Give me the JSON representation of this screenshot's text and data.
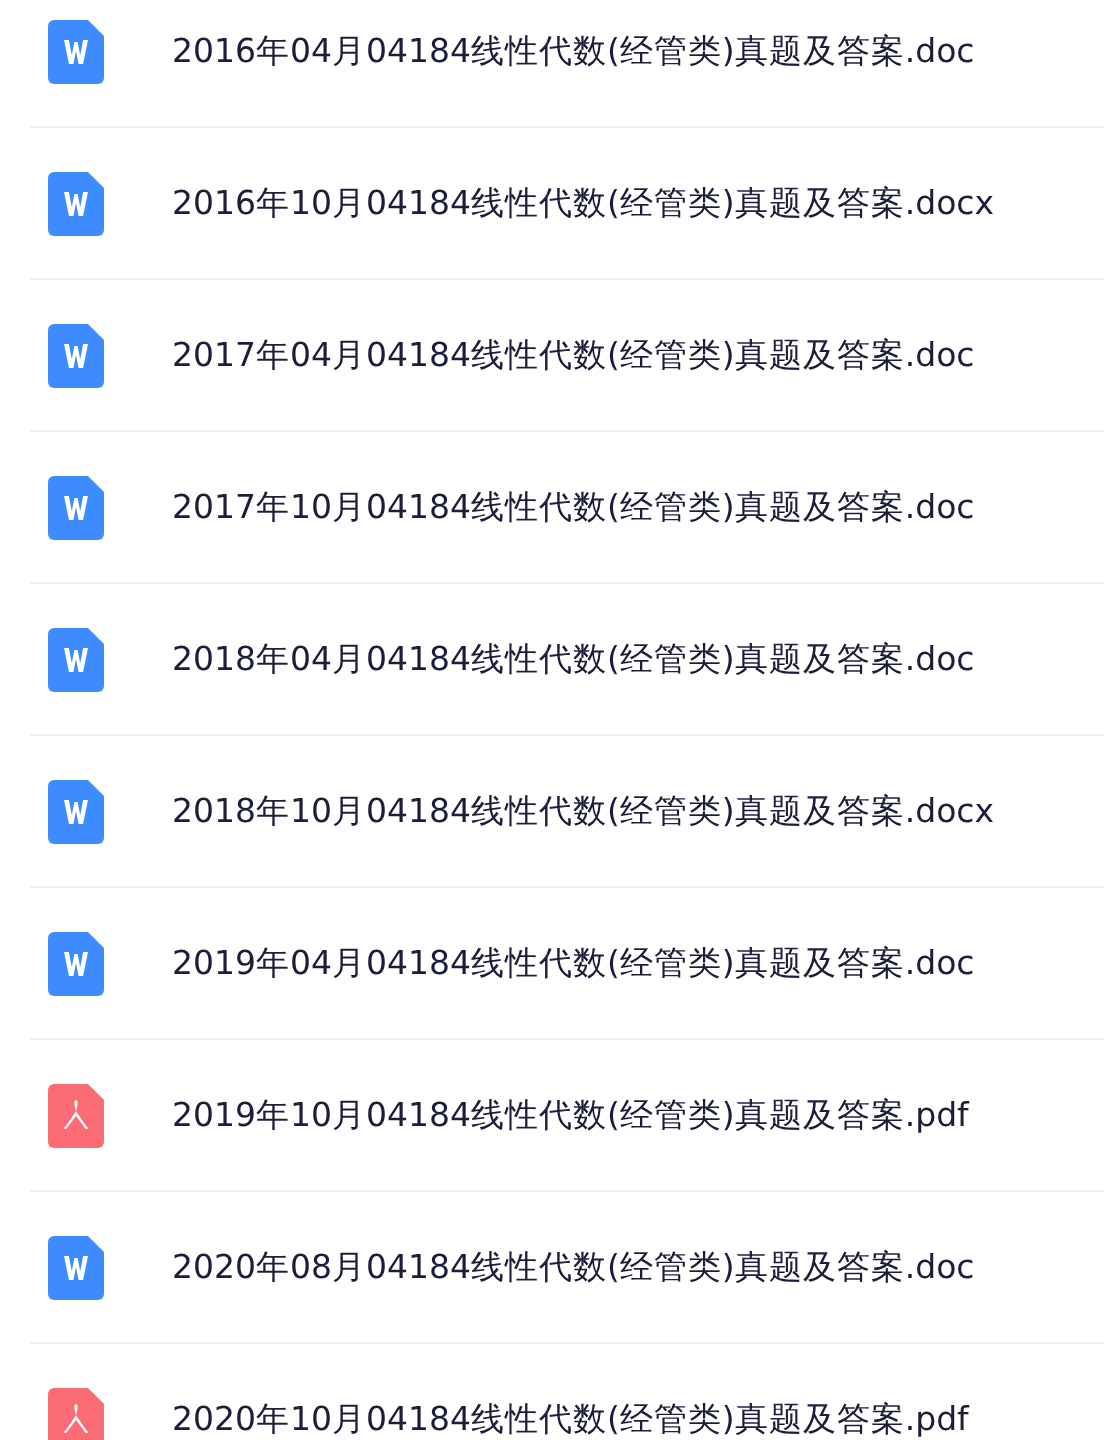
{
  "files": [
    {
      "kind": "doc",
      "name": "2016年04月04184线性代数(经管类)真题及答案.doc"
    },
    {
      "kind": "doc",
      "name": "2016年10月04184线性代数(经管类)真题及答案.docx"
    },
    {
      "kind": "doc",
      "name": "2017年04月04184线性代数(经管类)真题及答案.doc"
    },
    {
      "kind": "doc",
      "name": "2017年10月04184线性代数(经管类)真题及答案.doc"
    },
    {
      "kind": "doc",
      "name": "2018年04月04184线性代数(经管类)真题及答案.doc"
    },
    {
      "kind": "doc",
      "name": "2018年10月04184线性代数(经管类)真题及答案.docx"
    },
    {
      "kind": "doc",
      "name": "2019年04月04184线性代数(经管类)真题及答案.doc"
    },
    {
      "kind": "pdf",
      "name": "2019年10月04184线性代数(经管类)真题及答案.pdf"
    },
    {
      "kind": "doc",
      "name": "2020年08月04184线性代数(经管类)真题及答案.doc"
    },
    {
      "kind": "pdf",
      "name": "2020年10月04184线性代数(经管类)真题及答案.pdf"
    }
  ]
}
